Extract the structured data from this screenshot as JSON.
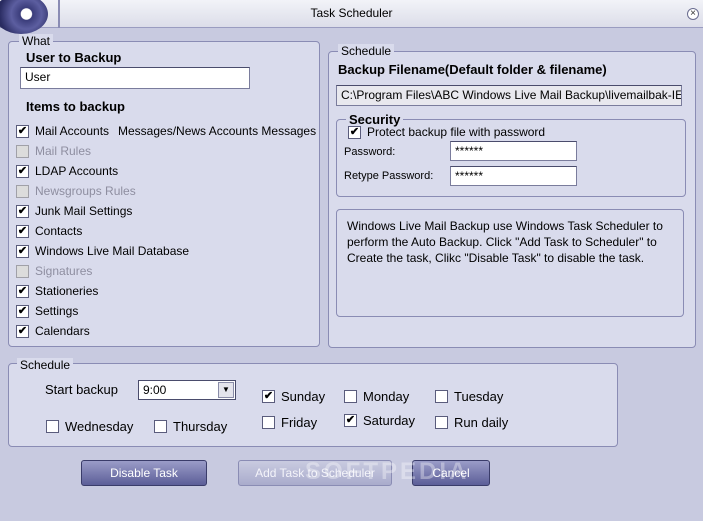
{
  "window": {
    "title": "Task Scheduler"
  },
  "what": {
    "legend": "What",
    "user_label": "User to Backup",
    "user_value": "User",
    "items_label": "Items to backup",
    "items": [
      {
        "label": "Mail Accounts",
        "checked": true,
        "disabled": false
      },
      {
        "label": "Mail Rules",
        "checked": false,
        "disabled": true
      },
      {
        "label": "LDAP Accounts",
        "checked": true,
        "disabled": false
      },
      {
        "label": "Newsgroups Rules",
        "checked": false,
        "disabled": true
      },
      {
        "label": "Junk Mail Settings",
        "checked": true,
        "disabled": false
      },
      {
        "label": "Contacts",
        "checked": true,
        "disabled": false
      },
      {
        "label": "Windows Live Mail Database",
        "checked": true,
        "disabled": false
      },
      {
        "label": "Signatures",
        "checked": false,
        "disabled": true
      },
      {
        "label": "Stationeries",
        "checked": true,
        "disabled": false
      },
      {
        "label": "Settings",
        "checked": true,
        "disabled": false
      },
      {
        "label": "Calendars",
        "checked": true,
        "disabled": false
      }
    ],
    "mail_accounts_extra": "Messages/News Accounts Messages"
  },
  "schedule_right": {
    "legend": "Schedule",
    "filename_label": "Backup Filename(Default folder & filename)",
    "filename_value": "C:\\Program Files\\ABC Windows Live Mail Backup\\livemailbak-IEU",
    "security": {
      "legend": "Security",
      "protect_label": "Protect backup file with password",
      "protect_checked": true,
      "password_label": "Password:",
      "password_value": "******",
      "retype_label": "Retype Password:",
      "retype_value": "******"
    },
    "info_text": "Windows Live Mail Backup use Windows Task Scheduler to perform the Auto Backup. Click \"Add Task to Scheduler\" to Create the task, Clikc \"Disable Task\" to disable the task."
  },
  "schedule_bottom": {
    "legend": "Schedule",
    "start_label": "Start backup",
    "start_value": "9:00",
    "days": [
      {
        "label": "Sunday",
        "checked": true
      },
      {
        "label": "Monday",
        "checked": false
      },
      {
        "label": "Tuesday",
        "checked": false
      },
      {
        "label": "Wednesday",
        "checked": false
      },
      {
        "label": "Thursday",
        "checked": false
      },
      {
        "label": "Friday",
        "checked": false
      },
      {
        "label": "Saturday",
        "checked": true
      },
      {
        "label": "Run daily",
        "checked": false
      }
    ]
  },
  "buttons": {
    "disable": "Disable Task",
    "add": "Add Task to Scheduler",
    "cancel": "Cancel"
  },
  "colors": {
    "background": "#c8cae0",
    "panel": "#d9dbec",
    "button": "#5c5e98"
  }
}
